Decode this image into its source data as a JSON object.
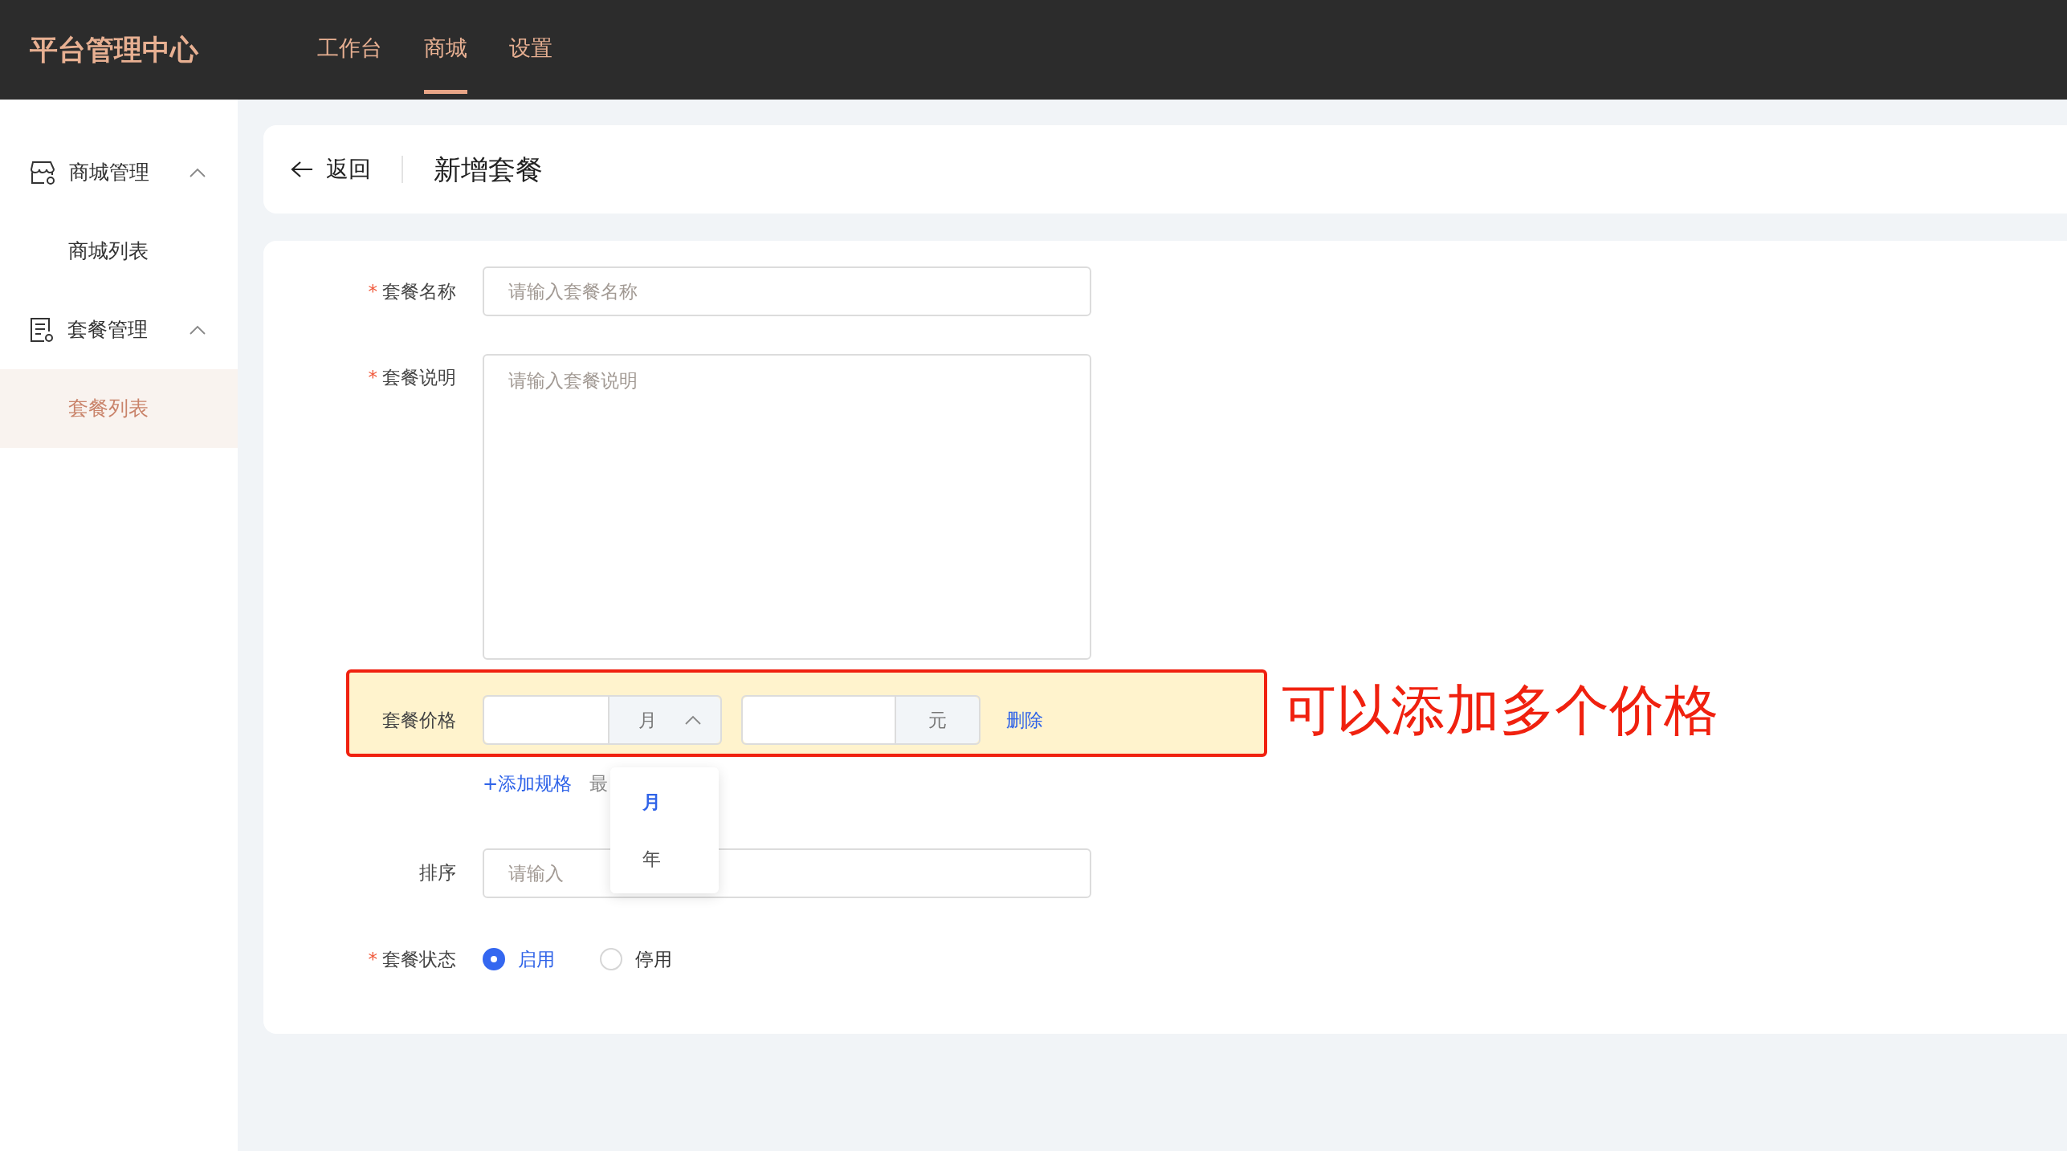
{
  "header": {
    "logo": "平台管理中心",
    "nav": [
      {
        "label": "工作台",
        "selected": false
      },
      {
        "label": "商城",
        "selected": true
      },
      {
        "label": "设置",
        "selected": false
      }
    ]
  },
  "sidebar": {
    "groups": [
      {
        "label": "商城管理",
        "expanded": true,
        "children": [
          {
            "label": "商城列表",
            "selected": false
          }
        ]
      },
      {
        "label": "套餐管理",
        "expanded": true,
        "children": [
          {
            "label": "套餐列表",
            "selected": true
          }
        ]
      }
    ]
  },
  "page_header": {
    "back": "返回",
    "title": "新增套餐"
  },
  "form": {
    "fields": [
      {
        "kind": "input",
        "label": "套餐名称",
        "required_mark": "*",
        "placeholder": "请输入套餐名称"
      },
      {
        "kind": "textarea",
        "label": "套餐说明",
        "required_mark": "*",
        "placeholder": "请输入套餐说明"
      },
      {
        "kind": "price",
        "label": "套餐价格",
        "unit": "月",
        "expanded": true,
        "currency": "元",
        "delete": "删除",
        "add": "+添加规格",
        "note": "最",
        "menu": [
          {
            "label": "月",
            "selected": true
          },
          {
            "label": "年",
            "selected": false
          }
        ]
      },
      {
        "kind": "input",
        "label": "排序",
        "placeholder": "请输入"
      },
      {
        "kind": "radio",
        "label": "套餐状态",
        "required_mark": "*",
        "options": [
          {
            "label": "启用",
            "selected": true
          },
          {
            "label": "停用",
            "selected": false
          }
        ]
      }
    ]
  },
  "annotation": {
    "text": "可以添加多个价格"
  }
}
